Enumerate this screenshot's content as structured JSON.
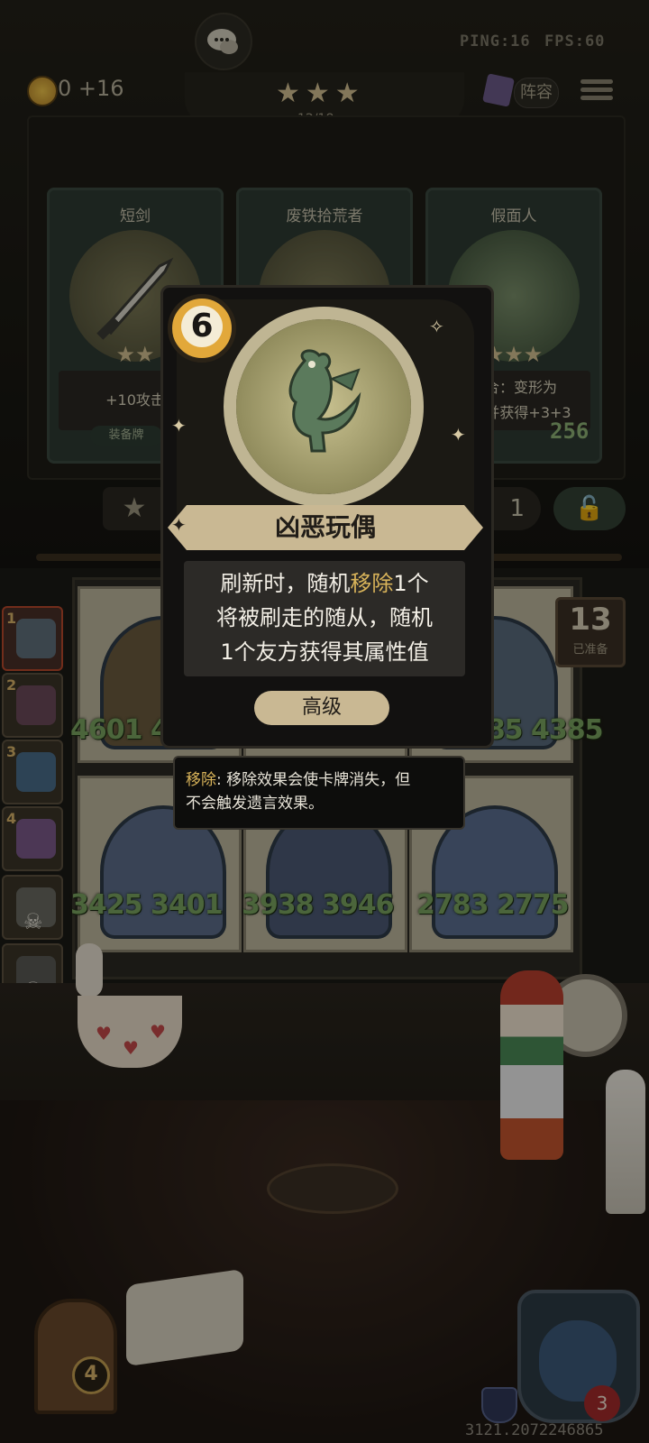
{
  "hud": {
    "ping": "PING:16",
    "fps": "FPS:60"
  },
  "gold": {
    "amount": "0",
    "income": "+16"
  },
  "tavern": {
    "stars": "★★★",
    "xp_text": "12/18",
    "xp_progress": 0.667
  },
  "top_buttons": {
    "lineup_label": "阵容"
  },
  "shop": {
    "cards": [
      {
        "name": "短剑",
        "stars": "★★",
        "desc": "+10攻击",
        "tag": "装备牌"
      },
      {
        "name": "废铁拾荒者",
        "stars": "",
        "desc": ""
      },
      {
        "name": "假面人",
        "stars": "★★★",
        "desc": "回合：变形为",
        "desc2": "从，并获得+3+3",
        "price": "256"
      }
    ],
    "refresh_cost": "1"
  },
  "popup": {
    "cost": "6",
    "title": "凶恶玩偶",
    "desc": [
      "刷新时，随机",
      "移除",
      "1个",
      "将被刷走的随从，随机",
      "1个友方获得其属性值"
    ],
    "rarity": "高级"
  },
  "tooltip": {
    "keyword": "移除",
    "text": ": 移除效果会使卡牌消失，但",
    "text2": "不会触发遗言效果。"
  },
  "board": {
    "row1": [
      "4601 4587",
      "",
      "4385 4385"
    ],
    "row2": [
      "3425 3401",
      "3938 3946",
      "2783 2775"
    ],
    "ready_count": "13",
    "ready_label": "已准备"
  },
  "sidebar": {
    "ranks": [
      "1",
      "2",
      "3",
      "4",
      "",
      "",
      "",
      ""
    ]
  },
  "bottom": {
    "tavern_level": "4",
    "hero_hp": "3",
    "coords": "3121.2072246865"
  }
}
